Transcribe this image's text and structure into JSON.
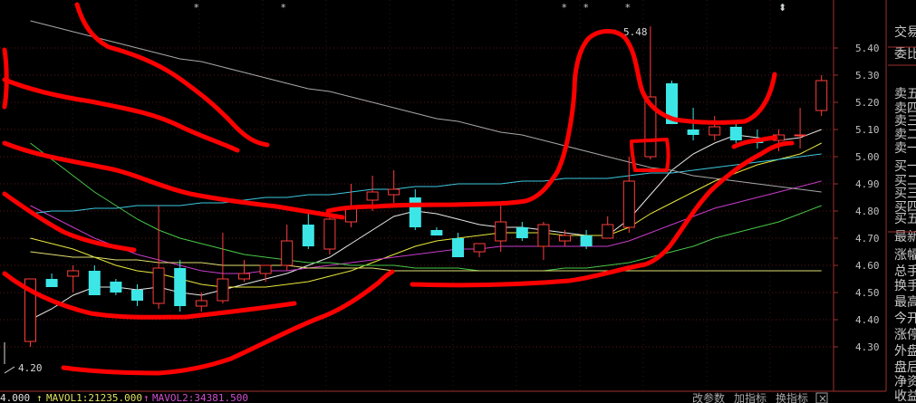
{
  "chart_data": {
    "type": "candlestick",
    "y_axis": {
      "ylim": [
        4.2,
        5.5
      ],
      "ticks": [
        "5.40",
        "5.30",
        "5.20",
        "5.10",
        "5.00",
        "4.90",
        "4.80",
        "4.70",
        "4.60",
        "4.50",
        "4.40",
        "4.30"
      ],
      "scale": "linear"
    },
    "grid": "dotted",
    "annotations": {
      "high_label": "5.48",
      "low_label": "4.20"
    },
    "candles": [
      {
        "o": 4.32,
        "h": 4.55,
        "l": 4.3,
        "c": 4.55,
        "color": "red"
      },
      {
        "o": 4.55,
        "h": 4.57,
        "l": 4.52,
        "c": 4.52,
        "color": "cyan"
      },
      {
        "o": 4.56,
        "h": 4.6,
        "l": 4.5,
        "c": 4.58,
        "color": "red"
      },
      {
        "o": 4.58,
        "h": 4.6,
        "l": 4.49,
        "c": 4.49,
        "color": "cyan"
      },
      {
        "o": 4.54,
        "h": 4.55,
        "l": 4.49,
        "c": 4.5,
        "color": "cyan"
      },
      {
        "o": 4.51,
        "h": 4.53,
        "l": 4.45,
        "c": 4.47,
        "color": "cyan"
      },
      {
        "o": 4.46,
        "h": 4.82,
        "l": 4.44,
        "c": 4.59,
        "color": "red"
      },
      {
        "o": 4.59,
        "h": 4.62,
        "l": 4.43,
        "c": 4.45,
        "color": "cyan"
      },
      {
        "o": 4.45,
        "h": 4.5,
        "l": 4.43,
        "c": 4.47,
        "color": "red"
      },
      {
        "o": 4.47,
        "h": 4.72,
        "l": 4.46,
        "c": 4.55,
        "color": "red"
      },
      {
        "o": 4.55,
        "h": 4.62,
        "l": 4.54,
        "c": 4.57,
        "color": "red"
      },
      {
        "o": 4.57,
        "h": 4.6,
        "l": 4.54,
        "c": 4.6,
        "color": "red"
      },
      {
        "o": 4.6,
        "h": 4.75,
        "l": 4.58,
        "c": 4.69,
        "color": "red"
      },
      {
        "o": 4.75,
        "h": 4.79,
        "l": 4.66,
        "c": 4.67,
        "color": "cyan"
      },
      {
        "o": 4.66,
        "h": 4.79,
        "l": 4.64,
        "c": 4.77,
        "color": "red"
      },
      {
        "o": 4.76,
        "h": 4.9,
        "l": 4.74,
        "c": 4.81,
        "color": "red"
      },
      {
        "o": 4.84,
        "h": 4.93,
        "l": 4.8,
        "c": 4.87,
        "color": "red"
      },
      {
        "o": 4.86,
        "h": 4.95,
        "l": 4.83,
        "c": 4.88,
        "color": "red"
      },
      {
        "o": 4.85,
        "h": 4.88,
        "l": 4.73,
        "c": 4.74,
        "color": "cyan"
      },
      {
        "o": 4.73,
        "h": 4.74,
        "l": 4.71,
        "c": 4.71,
        "color": "cyan"
      },
      {
        "o": 4.7,
        "h": 4.72,
        "l": 4.63,
        "c": 4.63,
        "color": "cyan"
      },
      {
        "o": 4.65,
        "h": 4.68,
        "l": 4.63,
        "c": 4.68,
        "color": "red"
      },
      {
        "o": 4.69,
        "h": 4.82,
        "l": 4.65,
        "c": 4.76,
        "color": "red"
      },
      {
        "o": 4.74,
        "h": 4.76,
        "l": 4.69,
        "c": 4.7,
        "color": "cyan"
      },
      {
        "o": 4.67,
        "h": 4.76,
        "l": 4.62,
        "c": 4.75,
        "color": "red"
      },
      {
        "o": 4.69,
        "h": 4.73,
        "l": 4.67,
        "c": 4.71,
        "color": "red"
      },
      {
        "o": 4.71,
        "h": 4.73,
        "l": 4.66,
        "c": 4.67,
        "color": "cyan"
      },
      {
        "o": 4.7,
        "h": 4.78,
        "l": 4.7,
        "c": 4.75,
        "color": "red"
      },
      {
        "o": 4.74,
        "h": 5.0,
        "l": 4.72,
        "c": 4.91,
        "color": "red"
      },
      {
        "o": 5.0,
        "h": 5.48,
        "l": 4.99,
        "c": 5.22,
        "color": "red"
      },
      {
        "o": 5.27,
        "h": 5.28,
        "l": 5.12,
        "c": 5.12,
        "color": "cyan"
      },
      {
        "o": 5.1,
        "h": 5.18,
        "l": 5.06,
        "c": 5.08,
        "color": "cyan"
      },
      {
        "o": 5.08,
        "h": 5.15,
        "l": 5.06,
        "c": 5.11,
        "color": "red"
      },
      {
        "o": 5.11,
        "h": 5.13,
        "l": 5.05,
        "c": 5.06,
        "color": "cyan"
      },
      {
        "o": 5.06,
        "h": 5.1,
        "l": 5.03,
        "c": 5.05,
        "color": "cyan"
      },
      {
        "o": 5.06,
        "h": 5.1,
        "l": 5.02,
        "c": 5.08,
        "color": "red"
      },
      {
        "o": 5.08,
        "h": 5.18,
        "l": 5.03,
        "c": 5.08,
        "color": "red"
      },
      {
        "o": 5.17,
        "h": 5.3,
        "l": 5.15,
        "c": 5.28,
        "color": "red"
      }
    ],
    "moving_averages": [
      {
        "color": "#e8e8e8",
        "values": [
          4.4,
          4.44,
          4.49,
          4.52,
          4.52,
          4.51,
          4.52,
          4.5,
          4.49,
          4.51,
          4.53,
          4.55,
          4.57,
          4.6,
          4.63,
          4.68,
          4.73,
          4.78,
          4.8,
          4.79,
          4.77,
          4.75,
          4.74,
          4.74,
          4.73,
          4.72,
          4.71,
          4.71,
          4.77,
          4.86,
          4.95,
          5.01,
          5.05,
          5.08,
          5.07,
          5.06,
          5.07,
          5.1
        ]
      },
      {
        "color": "#e8e83c",
        "values": [
          4.7,
          4.68,
          4.66,
          4.63,
          4.6,
          4.58,
          4.57,
          4.55,
          4.53,
          4.52,
          4.52,
          4.52,
          4.53,
          4.54,
          4.56,
          4.58,
          4.61,
          4.64,
          4.67,
          4.69,
          4.7,
          4.71,
          4.72,
          4.72,
          4.72,
          4.71,
          4.71,
          4.71,
          4.74,
          4.79,
          4.83,
          4.87,
          4.91,
          4.94,
          4.97,
          4.99,
          5.01,
          5.05
        ]
      },
      {
        "color": "#c83cc8",
        "values": [
          4.82,
          4.78,
          4.74,
          4.7,
          4.67,
          4.64,
          4.62,
          4.6,
          4.58,
          4.57,
          4.57,
          4.58,
          4.58,
          4.59,
          4.6,
          4.61,
          4.62,
          4.63,
          4.64,
          4.65,
          4.66,
          4.66,
          4.67,
          4.67,
          4.67,
          4.67,
          4.67,
          4.67,
          4.69,
          4.72,
          4.75,
          4.78,
          4.81,
          4.83,
          4.85,
          4.87,
          4.89,
          4.91
        ]
      },
      {
        "color": "#48c848",
        "values": [
          5.05,
          4.99,
          4.93,
          4.87,
          4.82,
          4.77,
          4.73,
          4.7,
          4.68,
          4.66,
          4.64,
          4.63,
          4.62,
          4.61,
          4.61,
          4.6,
          4.6,
          4.6,
          4.59,
          4.59,
          4.59,
          4.58,
          4.58,
          4.58,
          4.58,
          4.59,
          4.59,
          4.6,
          4.61,
          4.63,
          4.65,
          4.67,
          4.7,
          4.72,
          4.74,
          4.76,
          4.79,
          4.82
        ]
      },
      {
        "color": "#3cc8e0",
        "values": [
          4.79,
          4.8,
          4.8,
          4.81,
          4.81,
          4.82,
          4.82,
          4.82,
          4.83,
          4.83,
          4.84,
          4.85,
          4.85,
          4.86,
          4.86,
          4.87,
          4.88,
          4.88,
          4.89,
          4.89,
          4.9,
          4.9,
          4.9,
          4.91,
          4.91,
          4.92,
          4.92,
          4.92,
          4.93,
          4.94,
          4.94,
          4.95,
          4.96,
          4.97,
          4.98,
          4.99,
          5.0,
          5.01
        ]
      },
      {
        "color": "#a8a8a8",
        "values": [
          5.5,
          5.48,
          5.46,
          5.44,
          5.42,
          5.4,
          5.38,
          5.36,
          5.35,
          5.33,
          5.31,
          5.29,
          5.27,
          5.25,
          5.24,
          5.22,
          5.2,
          5.18,
          5.16,
          5.14,
          5.13,
          5.11,
          5.09,
          5.08,
          5.06,
          5.04,
          5.02,
          5.0,
          4.98,
          4.96,
          4.95,
          4.93,
          4.92,
          4.91,
          4.9,
          4.89,
          4.88,
          4.87
        ]
      },
      {
        "color": "#e0e070",
        "values": [
          4.65,
          4.64,
          4.63,
          4.63,
          4.62,
          4.62,
          4.61,
          4.61,
          4.61,
          4.6,
          4.6,
          4.6,
          4.6,
          4.59,
          4.59,
          4.59,
          4.59,
          4.58,
          4.58,
          4.58,
          4.58,
          4.58,
          4.58,
          4.58,
          4.58,
          4.58,
          4.58,
          4.58,
          4.58,
          4.58,
          4.58,
          4.58,
          4.58,
          4.58,
          4.58,
          4.58,
          4.58,
          4.58
        ]
      }
    ]
  },
  "top_markers": [
    "*",
    "*",
    "*",
    "*",
    "*",
    "⬍"
  ],
  "right_panel": {
    "labels": [
      "交易",
      "委比",
      "卖五",
      "卖四",
      "卖三",
      "卖二",
      "卖一",
      "买一",
      "买二",
      "买三",
      "买四",
      "买五",
      "最新",
      "涨幅",
      "总手",
      "换手",
      "最高",
      "今开",
      "涨停",
      "外盘",
      "盘后",
      "净资",
      "收益"
    ]
  },
  "status_bar": {
    "vol_value": "4.000",
    "mavol1": "MAVOL1:21235.000",
    "mavol2": "MAVOL2:34381.500",
    "buttons": [
      "改参数",
      "加指标",
      "换指标"
    ],
    "close": "×"
  },
  "colors": {
    "up": "#ff3c3c",
    "down": "#3ce6e6",
    "hand_drawn": "#ff0000",
    "background": "#000000"
  }
}
